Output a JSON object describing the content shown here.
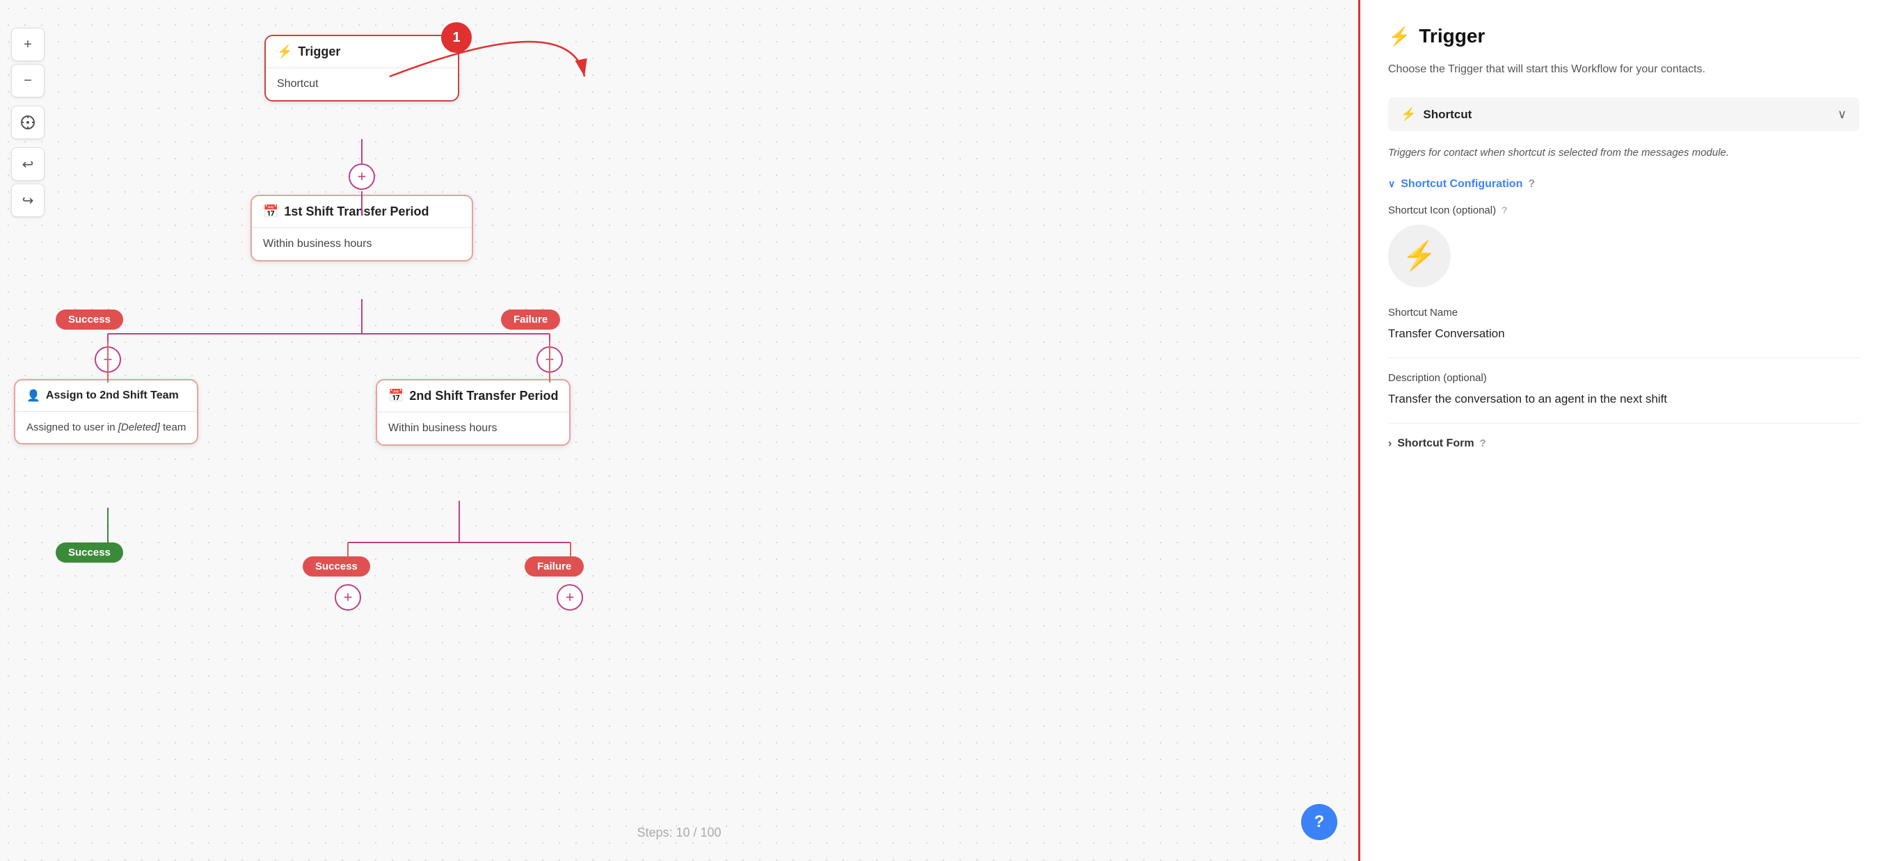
{
  "toolbar": {
    "zoom_in": "+",
    "zoom_out": "−",
    "center": "⊕"
  },
  "canvas": {
    "trigger_node": {
      "title": "Trigger",
      "value": "Shortcut",
      "step_badge": "1"
    },
    "shift1_node": {
      "title": "1st Shift Transfer Period",
      "value": "Within business hours"
    },
    "success_label": "Success",
    "failure_label": "Failure",
    "assign_node": {
      "title": "Assign to 2nd Shift Team",
      "body_prefix": "Assigned to user in ",
      "body_italic": "[Deleted]",
      "body_suffix": " team"
    },
    "shift2_node": {
      "title": "2nd Shift Transfer Period",
      "value": "Within business hours"
    },
    "success2_label": "Success",
    "failure2_label": "Failure",
    "success_green_label": "Success",
    "steps_counter": "Steps: 10 / 100"
  },
  "panel": {
    "title": "Trigger",
    "description": "Choose the Trigger that will start this Workflow for your contacts.",
    "trigger_selector": {
      "label": "Shortcut",
      "chevron": "∨"
    },
    "trigger_description": "Triggers for contact when shortcut is selected from the messages module.",
    "shortcut_config": {
      "label": "Shortcut Configuration",
      "help": "?"
    },
    "shortcut_icon_label": "Shortcut Icon (optional)",
    "shortcut_icon_help": "?",
    "shortcut_icon_symbol": "⚡",
    "shortcut_name_label": "Shortcut Name",
    "shortcut_name_value": "Transfer Conversation",
    "description_label": "Description (optional)",
    "description_value": "Transfer the conversation to an agent in the next shift",
    "shortcut_form_label": "Shortcut Form",
    "shortcut_form_help": "?"
  },
  "help_btn": "?"
}
